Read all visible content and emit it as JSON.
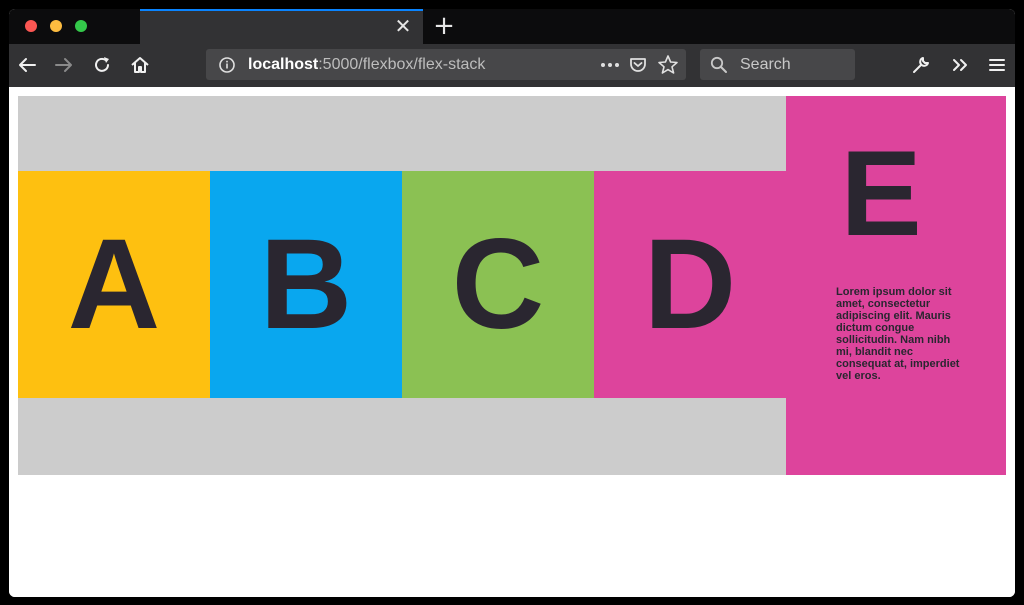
{
  "browser": {
    "tab": {
      "close_glyph": "✕"
    },
    "new_tab_glyph": "+",
    "url": {
      "host": "localhost",
      "rest": ":5000/flexbox/flex-stack"
    },
    "search": {
      "placeholder": "Search"
    },
    "icons": [
      "back-icon",
      "forward-icon",
      "reload-icon",
      "home-icon",
      "info-icon",
      "more-icon",
      "pocket-icon",
      "bookmark-star-icon",
      "search-icon",
      "wrench-icon",
      "overflow-chevrons-icon",
      "menu-icon"
    ]
  },
  "page": {
    "boxes": [
      {
        "label": "A",
        "color": "#fec010"
      },
      {
        "label": "B",
        "color": "#09a7ef"
      },
      {
        "label": "C",
        "color": "#8bc153"
      },
      {
        "label": "D",
        "color": "#dd449c"
      }
    ],
    "e_box": {
      "label": "E",
      "color": "#dd449c",
      "text": "Lorem ipsum dolor sit amet, consectetur adipiscing elit. Mauris dictum congue sollicitudin. Nam nibh mi, blandit nec consequat at, imperdiet vel eros."
    },
    "container_color": "#cccccc"
  }
}
